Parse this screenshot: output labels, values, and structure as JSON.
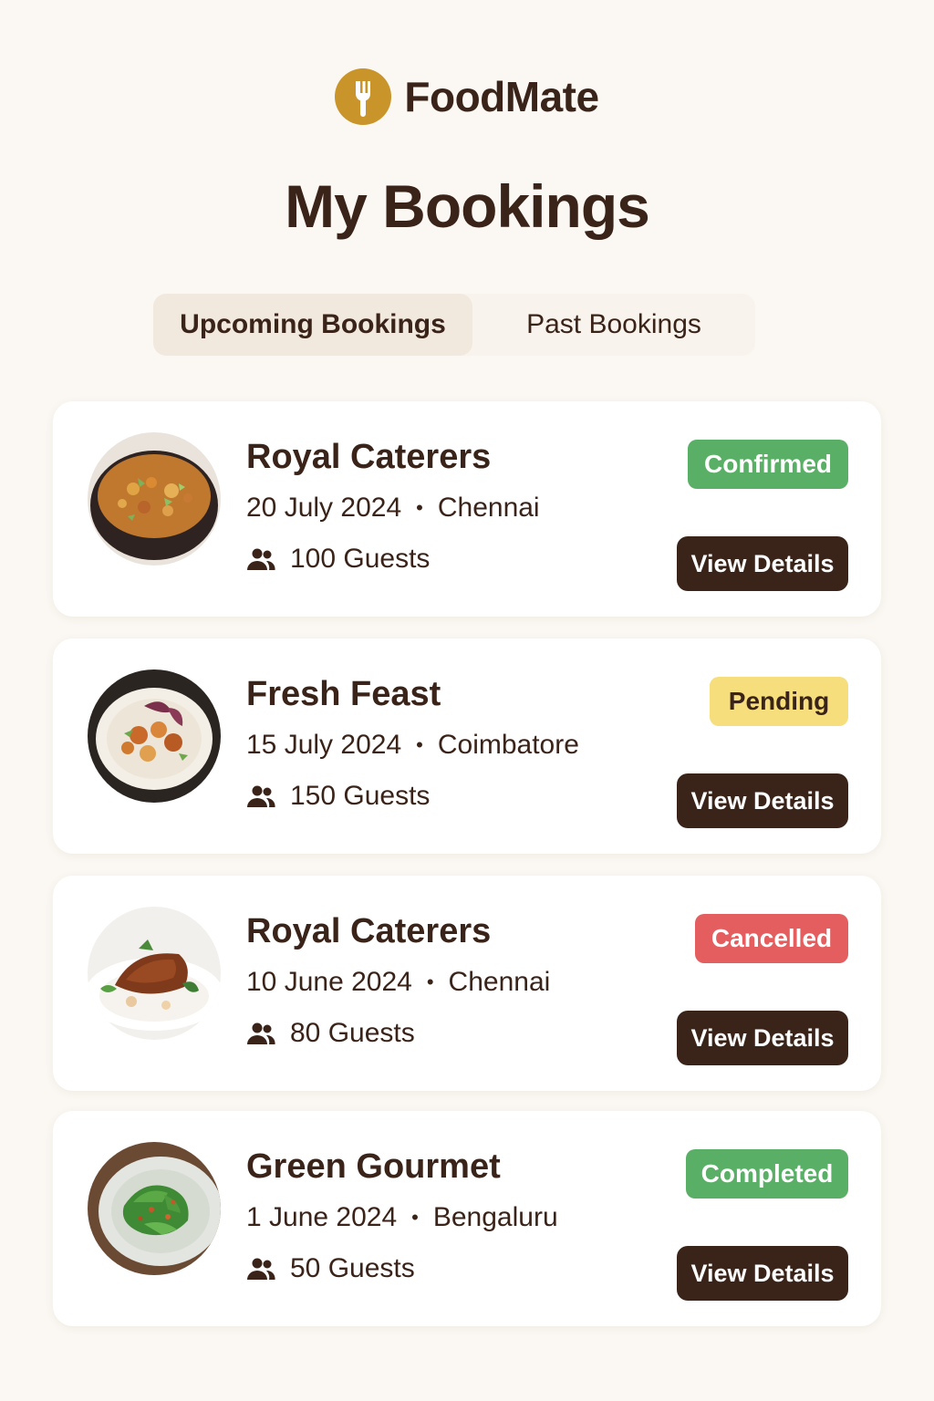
{
  "app": {
    "brand": "FoodMate",
    "logo_icon": "fork-icon",
    "accent_color": "#c9952a"
  },
  "page": {
    "title": "My Bookings"
  },
  "tabs": [
    {
      "label": "Upcoming Bookings",
      "active": true
    },
    {
      "label": "Past Bookings",
      "active": false
    }
  ],
  "bookings": [
    {
      "name": "Royal Caterers",
      "date": "20 July 2024",
      "city": "Chennai",
      "guests": "100 Guests",
      "status": "Confirmed",
      "status_color": "#5aaf66",
      "action": "View Details",
      "image": "dish-bowl-curry"
    },
    {
      "name": "Fresh Feast",
      "date": "15 July 2024",
      "city": "Coimbatore",
      "guests": "150 Guests",
      "status": "Pending",
      "status_color": "#f6de7c",
      "action": "View Details",
      "image": "dish-plate-stirfry"
    },
    {
      "name": "Royal Caterers",
      "date": "10 June 2024",
      "city": "Chennai",
      "guests": "80 Guests",
      "status": "Cancelled",
      "status_color": "#e45d5f",
      "action": "View Details",
      "image": "dish-glazed-chicken"
    },
    {
      "name": "Green Gourmet",
      "date": "1 June 2024",
      "city": "Bengaluru",
      "guests": "50 Guests",
      "status": "Completed",
      "status_color": "#5aaf66",
      "action": "View Details",
      "image": "dish-green-salad"
    }
  ],
  "separator": "•",
  "guests_icon": "people-icon"
}
